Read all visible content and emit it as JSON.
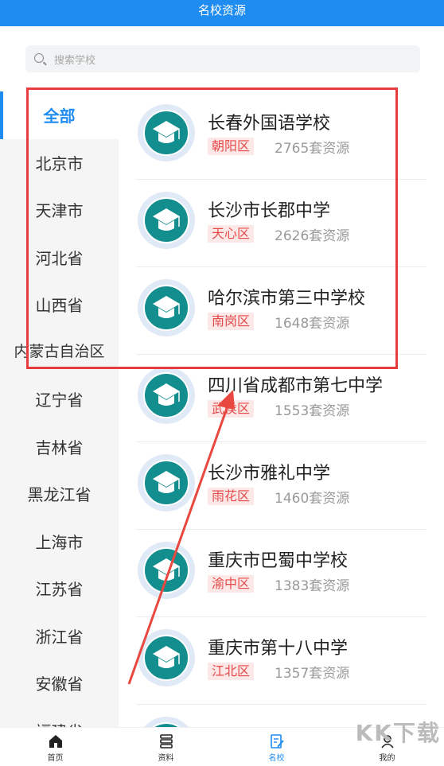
{
  "header": {
    "title": "名校资源"
  },
  "search": {
    "placeholder": "搜索学校"
  },
  "sidebar": {
    "items": [
      {
        "label": "全部",
        "active": true
      },
      {
        "label": "北京市"
      },
      {
        "label": "天津市"
      },
      {
        "label": "河北省"
      },
      {
        "label": "山西省"
      },
      {
        "label": "内蒙古自治区",
        "two_line": true
      },
      {
        "label": "辽宁省"
      },
      {
        "label": "吉林省"
      },
      {
        "label": "黑龙江省"
      },
      {
        "label": "上海市"
      },
      {
        "label": "江苏省"
      },
      {
        "label": "浙江省"
      },
      {
        "label": "安徽省"
      },
      {
        "label": "福建省"
      }
    ]
  },
  "schools": [
    {
      "name": "长春外国语学校",
      "district": "朝阳区",
      "count": "2765套资源"
    },
    {
      "name": "长沙市长郡中学",
      "district": "天心区",
      "count": "2626套资源"
    },
    {
      "name": "哈尔滨市第三中学校",
      "district": "南岗区",
      "count": "1648套资源"
    },
    {
      "name": "四川省成都市第七中学",
      "district": "武侯区",
      "count": "1553套资源"
    },
    {
      "name": "长沙市雅礼中学",
      "district": "雨花区",
      "count": "1460套资源"
    },
    {
      "name": "重庆市巴蜀中学校",
      "district": "渝中区",
      "count": "1383套资源"
    },
    {
      "name": "重庆市第十八中学",
      "district": "江北区",
      "count": "1357套资源"
    },
    {
      "name": "",
      "district": "",
      "count": ""
    }
  ],
  "bottom_nav": [
    {
      "label": "首页",
      "icon": "home-icon"
    },
    {
      "label": "资料",
      "icon": "database-icon"
    },
    {
      "label": "名校",
      "icon": "edit-icon",
      "active": true
    },
    {
      "label": "我的",
      "icon": "user-icon"
    }
  ],
  "watermark": {
    "text": "KK下载"
  },
  "colors": {
    "accent": "#1e8cf0",
    "badge_text": "#e54a4a",
    "badge_bg": "#fde8e8",
    "logo": "#138e8e",
    "annotation": "#e83b3b"
  }
}
